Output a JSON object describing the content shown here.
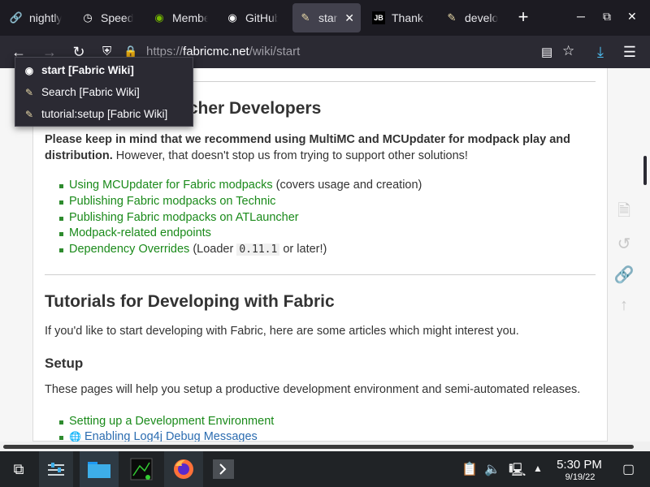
{
  "tabs": [
    {
      "label": "nightly",
      "icon": "chain-icon"
    },
    {
      "label": "Speedt",
      "icon": "speedometer-icon"
    },
    {
      "label": "Membe",
      "icon": "nvidia-icon"
    },
    {
      "label": "GitHub",
      "icon": "github-icon"
    },
    {
      "label": "start",
      "icon": "wiki-pencil-icon"
    },
    {
      "label": "Thank y",
      "icon": "jb-icon"
    },
    {
      "label": "develo",
      "icon": "wiki-pencil-icon"
    }
  ],
  "url": {
    "prefix": "https://",
    "host": "fabricmc.net",
    "path": "/wiki/start"
  },
  "dropdown": [
    {
      "label": "start [Fabric Wiki]"
    },
    {
      "label": "Search [Fabric Wiki]"
    },
    {
      "label": "tutorial:setup [Fabric Wiki]"
    }
  ],
  "page": {
    "launcher_heading": "ncher Developers",
    "intro_bold": "Please keep in mind that we recommend using MultiMC and MCUpdater for modpack play and distribution.",
    "intro_rest": " However, that doesn't stop us from trying to support other solutions!",
    "launcher_links": [
      {
        "link": "Using MCUpdater for Fabric modpacks",
        "tail": " (covers usage and creation)"
      },
      {
        "link": "Publishing Fabric modpacks on Technic",
        "tail": ""
      },
      {
        "link": "Publishing Fabric modpacks on ATLauncher",
        "tail": ""
      },
      {
        "link": "Modpack-related endpoints",
        "tail": ""
      },
      {
        "link": "Dependency Overrides",
        "tail_pre": " (Loader ",
        "code": "0.11.1",
        "tail_post": " or later!)"
      }
    ],
    "tutorials_heading": "Tutorials for Developing with Fabric",
    "tutorials_intro": "If you'd like to start developing with Fabric, here are some articles which might interest you.",
    "setup_heading": "Setup",
    "setup_intro": "These pages will help you setup a productive development environment and semi-automated releases.",
    "setup_links": [
      {
        "link": "Setting up a Development Environment"
      },
      {
        "link": "Enabling Log4j Debug Messages"
      }
    ]
  },
  "taskbar": {
    "time": "5:30 PM",
    "date": "9/19/22"
  }
}
